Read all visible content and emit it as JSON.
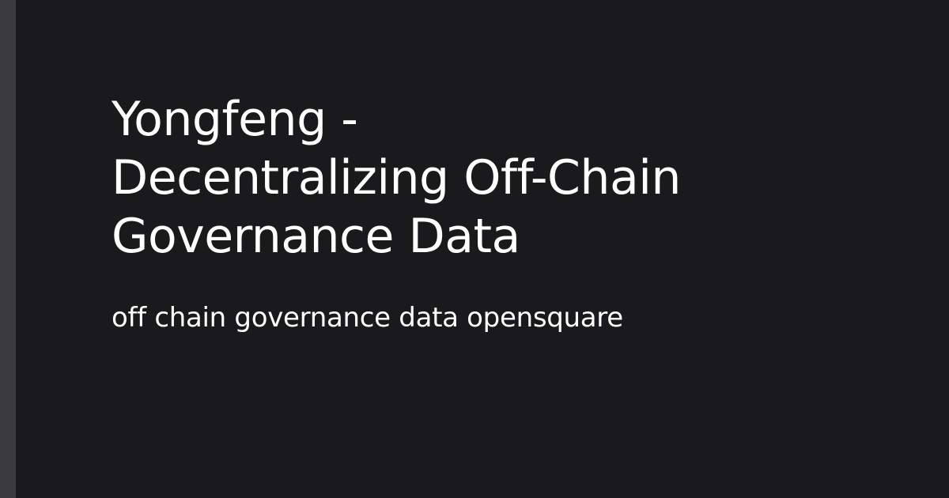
{
  "card": {
    "title_lines": [
      "Yongfeng -",
      "Decentralizing Off-Chain",
      "Governance Data"
    ],
    "subtitle": "off chain governance data opensquare"
  },
  "colors": {
    "background": "#1a1a1c",
    "accent_bar": "#3a3a3f",
    "text": "#ffffff"
  }
}
